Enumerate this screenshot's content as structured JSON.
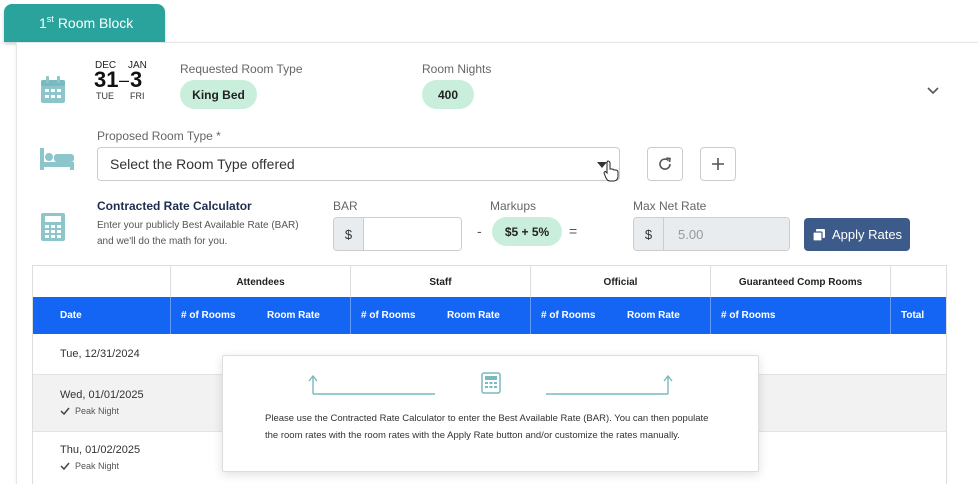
{
  "tab": {
    "sup": "st",
    "number": "1",
    "label": "Room Block"
  },
  "block": {
    "start": {
      "month": "DEC",
      "day": "31",
      "weekday": "TUE"
    },
    "separator": "–",
    "end": {
      "month": "JAN",
      "day": "3",
      "weekday": "FRI"
    },
    "requested_room_type_label": "Requested Room Type",
    "requested_room_type_value": "King Bed",
    "room_nights_label": "Room Nights",
    "room_nights_value": "400"
  },
  "proposed": {
    "label": "Proposed Room Type *",
    "select_value": "Select the Room Type offered"
  },
  "calculator": {
    "title": "Contracted Rate Calculator",
    "description": "Enter your publicly Best Available Rate (BAR) and we'll do the math for you.",
    "bar_label": "BAR",
    "currency": "$",
    "bar_value": "",
    "minus": "-",
    "markups_label": "Markups",
    "markups_value": "$5 + 5%",
    "equals": "=",
    "max_net_rate_label": "Max Net Rate",
    "max_net_rate_value": "5.00",
    "apply_button": "Apply Rates"
  },
  "table": {
    "groups": [
      "Attendees",
      "Staff",
      "Official",
      "Guaranteed Comp Rooms"
    ],
    "headers": {
      "date": "Date",
      "rooms": "# of Rooms",
      "rate": "Room Rate",
      "total": "Total"
    },
    "rows": [
      {
        "date": "Tue, 12/31/2024",
        "peak": ""
      },
      {
        "date": "Wed, 01/01/2025",
        "peak": "Peak Night"
      },
      {
        "date": "Thu, 01/02/2025",
        "peak": "Peak Night"
      }
    ]
  },
  "popup": {
    "message": "Please use the Contracted Rate Calculator to enter the Best Available Rate (BAR). You can then populate the room rates with the room rates with the Apply Rate button and/or customize the rates manually."
  },
  "colors": {
    "tab": "#2aa39c",
    "header": "#1565f5",
    "pill": "#c9efdc",
    "apply": "#3c5a8a",
    "icon": "#8cc6cb"
  }
}
